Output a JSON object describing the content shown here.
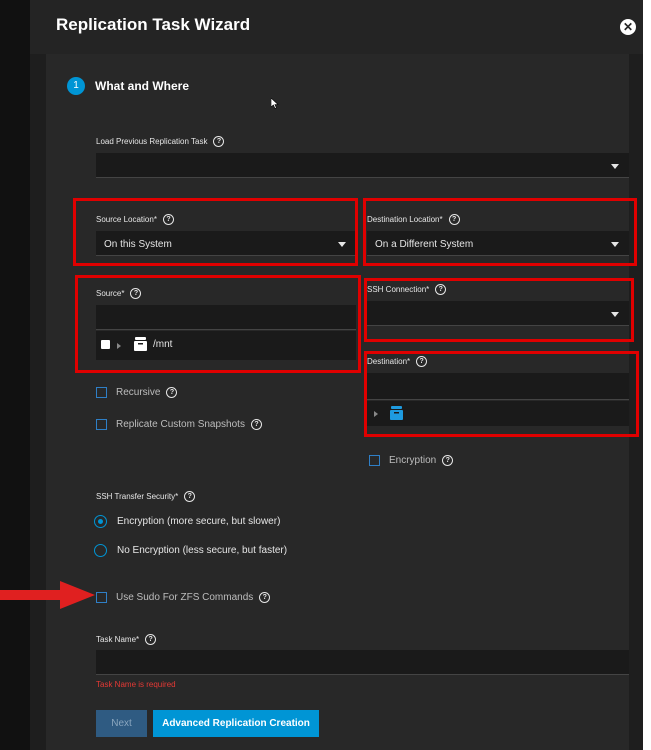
{
  "dialog": {
    "title": "Replication Task Wizard",
    "close_glyph": "✕"
  },
  "step": {
    "number": "1",
    "title": "What and Where"
  },
  "load_previous": {
    "label": "Load Previous Replication Task",
    "value": ""
  },
  "source_location": {
    "label": "Source Location",
    "value": "On this System"
  },
  "destination_location": {
    "label": "Destination Location",
    "value": "On a Different System"
  },
  "source": {
    "label": "Source",
    "value": "",
    "tree_path": "/mnt"
  },
  "ssh_connection": {
    "label": "SSH Connection",
    "value": ""
  },
  "destination": {
    "label": "Destination",
    "value": ""
  },
  "options": {
    "recursive": "Recursive",
    "replicate_custom": "Replicate Custom Snapshots",
    "encryption": "Encryption",
    "use_sudo": "Use Sudo For ZFS Commands"
  },
  "ssh_transfer_security": {
    "label": "SSH Transfer Security",
    "options": [
      "Encryption (more secure, but slower)",
      "No Encryption (less secure, but faster)"
    ],
    "selected": "Encryption (more secure, but slower)"
  },
  "task_name": {
    "label": "Task Name",
    "value": "",
    "error": "Task Name is required"
  },
  "buttons": {
    "next": "Next",
    "advanced": "Advanced Replication Creation"
  },
  "required_mark": "*",
  "help_glyph": "?",
  "colors": {
    "accent": "#0095d5",
    "highlight": "#e00000",
    "arrow": "#e02020",
    "error": "#e53935"
  }
}
